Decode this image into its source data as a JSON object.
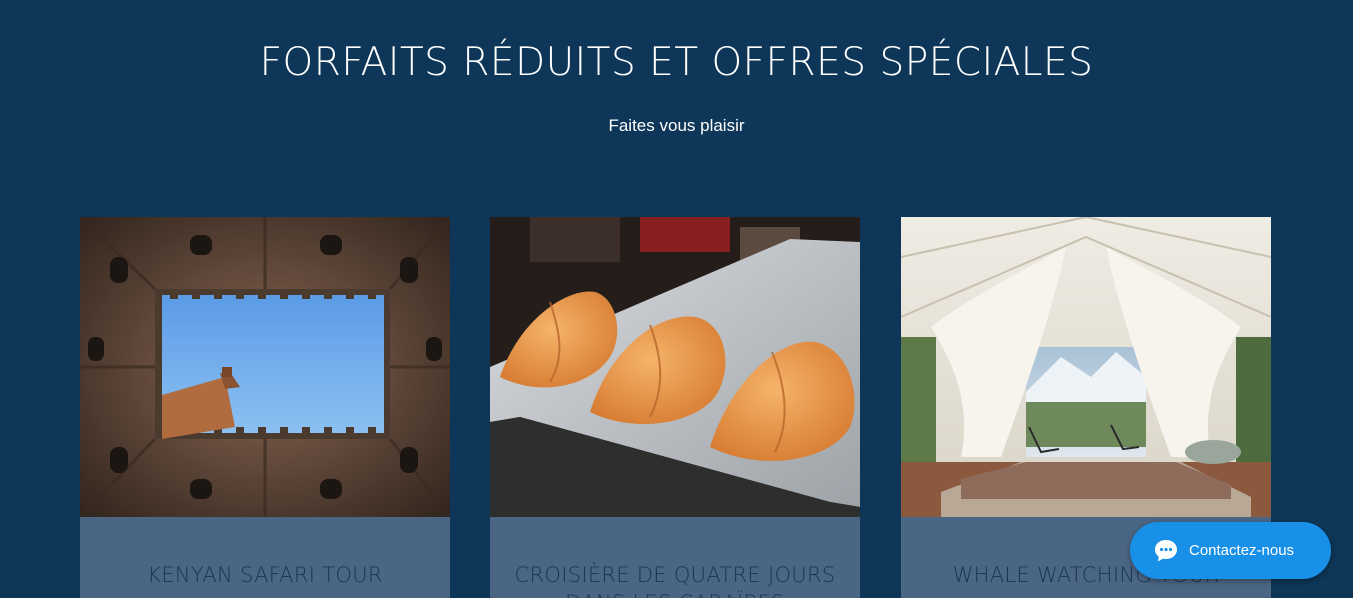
{
  "section": {
    "title": "FORFAITS RÉDUITS ET OFFRES SPÉCIALES",
    "subtitle": "Faites vous plaisir"
  },
  "cards": [
    {
      "title": "KENYAN SAFARI TOUR",
      "image": "courtyard-tower-photo"
    },
    {
      "title": "CROISIÈRE DE QUATRE JOURS DANS LES CARAÏBES",
      "image": "fortune-cookies-photo"
    },
    {
      "title": "WHALE WATCHING TOUR",
      "image": "glamping-tent-photo"
    }
  ],
  "chat": {
    "label": "Contactez-nous",
    "icon": "chat-bubble-icon"
  },
  "colors": {
    "background": "#0d3658",
    "card_body": "#4a6683",
    "card_title": "#1a3552",
    "chat_button": "#1990e8"
  }
}
